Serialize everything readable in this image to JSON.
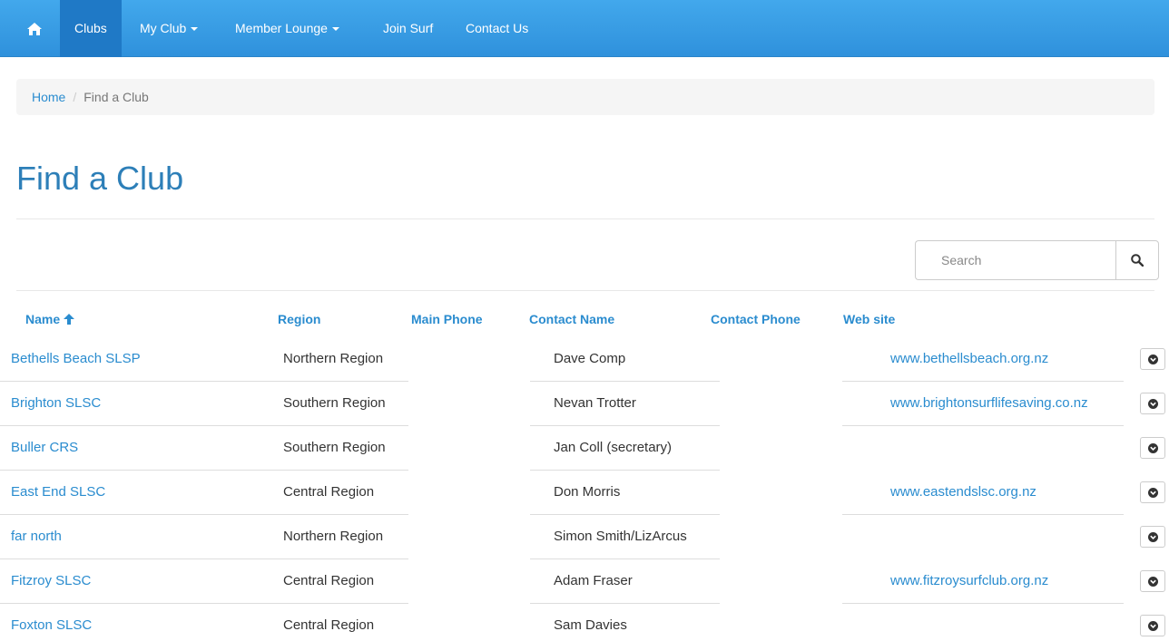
{
  "nav": {
    "home_icon": "home-icon",
    "items": [
      {
        "label": "Clubs",
        "active": true
      },
      {
        "label": "My Club",
        "dropdown": true
      },
      {
        "label": "Member Lounge",
        "dropdown": true
      },
      {
        "label": "Join Surf"
      },
      {
        "label": "Contact Us"
      }
    ]
  },
  "breadcrumb": {
    "home": "Home",
    "separator": "/",
    "current": "Find a Club"
  },
  "page": {
    "title": "Find a Club"
  },
  "search": {
    "placeholder": "Search",
    "icon": "search-icon"
  },
  "table": {
    "columns": [
      {
        "label": "Name",
        "sort": "ascending",
        "sort_icon": "arrow-up-icon"
      },
      {
        "label": "Region"
      },
      {
        "label": "Main Phone"
      },
      {
        "label": "Contact Name"
      },
      {
        "label": "Contact Phone"
      },
      {
        "label": "Web site"
      }
    ],
    "rows": [
      {
        "name": "Bethells Beach SLSP",
        "region": "Northern Region",
        "main_phone": "",
        "contact_name": "Dave Comp",
        "contact_phone": "",
        "website": "www.bethellsbeach.org.nz"
      },
      {
        "name": "Brighton SLSC",
        "region": "Southern Region",
        "main_phone": "",
        "contact_name": "Nevan Trotter",
        "contact_phone": "",
        "website": "www.brightonsurflifesaving.co.nz"
      },
      {
        "name": "Buller CRS",
        "region": "Southern Region",
        "main_phone": "",
        "contact_name": "Jan Coll (secretary)",
        "contact_phone": "",
        "website": ""
      },
      {
        "name": "East End SLSC",
        "region": "Central Region",
        "main_phone": "",
        "contact_name": "Don Morris",
        "contact_phone": "",
        "website": "www.eastendslsc.org.nz"
      },
      {
        "name": "far north",
        "region": "Northern Region",
        "main_phone": "",
        "contact_name": "Simon Smith/LizArcus",
        "contact_phone": "",
        "website": ""
      },
      {
        "name": "Fitzroy SLSC",
        "region": "Central Region",
        "main_phone": "",
        "contact_name": "Adam Fraser",
        "contact_phone": "",
        "website": "www.fitzroysurfclub.org.nz"
      },
      {
        "name": "Foxton SLSC",
        "region": "Central Region",
        "main_phone": "",
        "contact_name": "Sam Davies",
        "contact_phone": "",
        "website": ""
      }
    ],
    "row_toggle_icon": "chevron-circle-down-icon"
  },
  "colors": {
    "navbar": "#3a9fe6",
    "nav_active": "#1f79c6",
    "link": "#2a8ccf",
    "title": "#2d7fb8"
  }
}
